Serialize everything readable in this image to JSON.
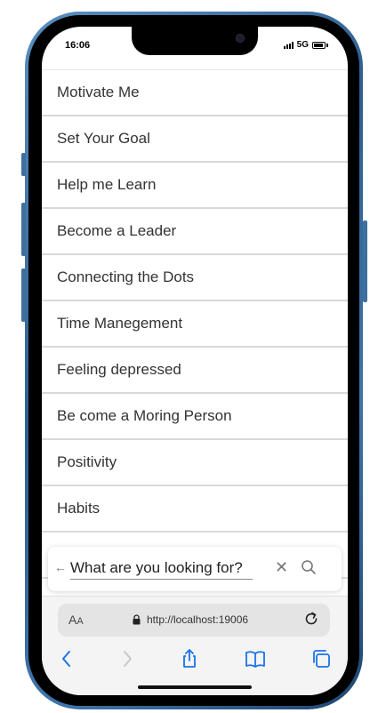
{
  "status_bar": {
    "time": "16:06",
    "network": "5G"
  },
  "list": {
    "items": [
      "Motivate Me",
      "Set Your Goal",
      "Help me Learn",
      "Become a Leader",
      "Connecting the Dots",
      "Time Manegement",
      "Feeling depressed",
      "Be come a Moring Person",
      "Positivity",
      "Habits"
    ]
  },
  "search": {
    "placeholder": "What are you looking for?"
  },
  "browser": {
    "text_size_label": "A",
    "text_size_label_small": "A",
    "url": "http://localhost:19006"
  },
  "colors": {
    "frame": "#3f75aa",
    "accent": "#1a73e8"
  }
}
